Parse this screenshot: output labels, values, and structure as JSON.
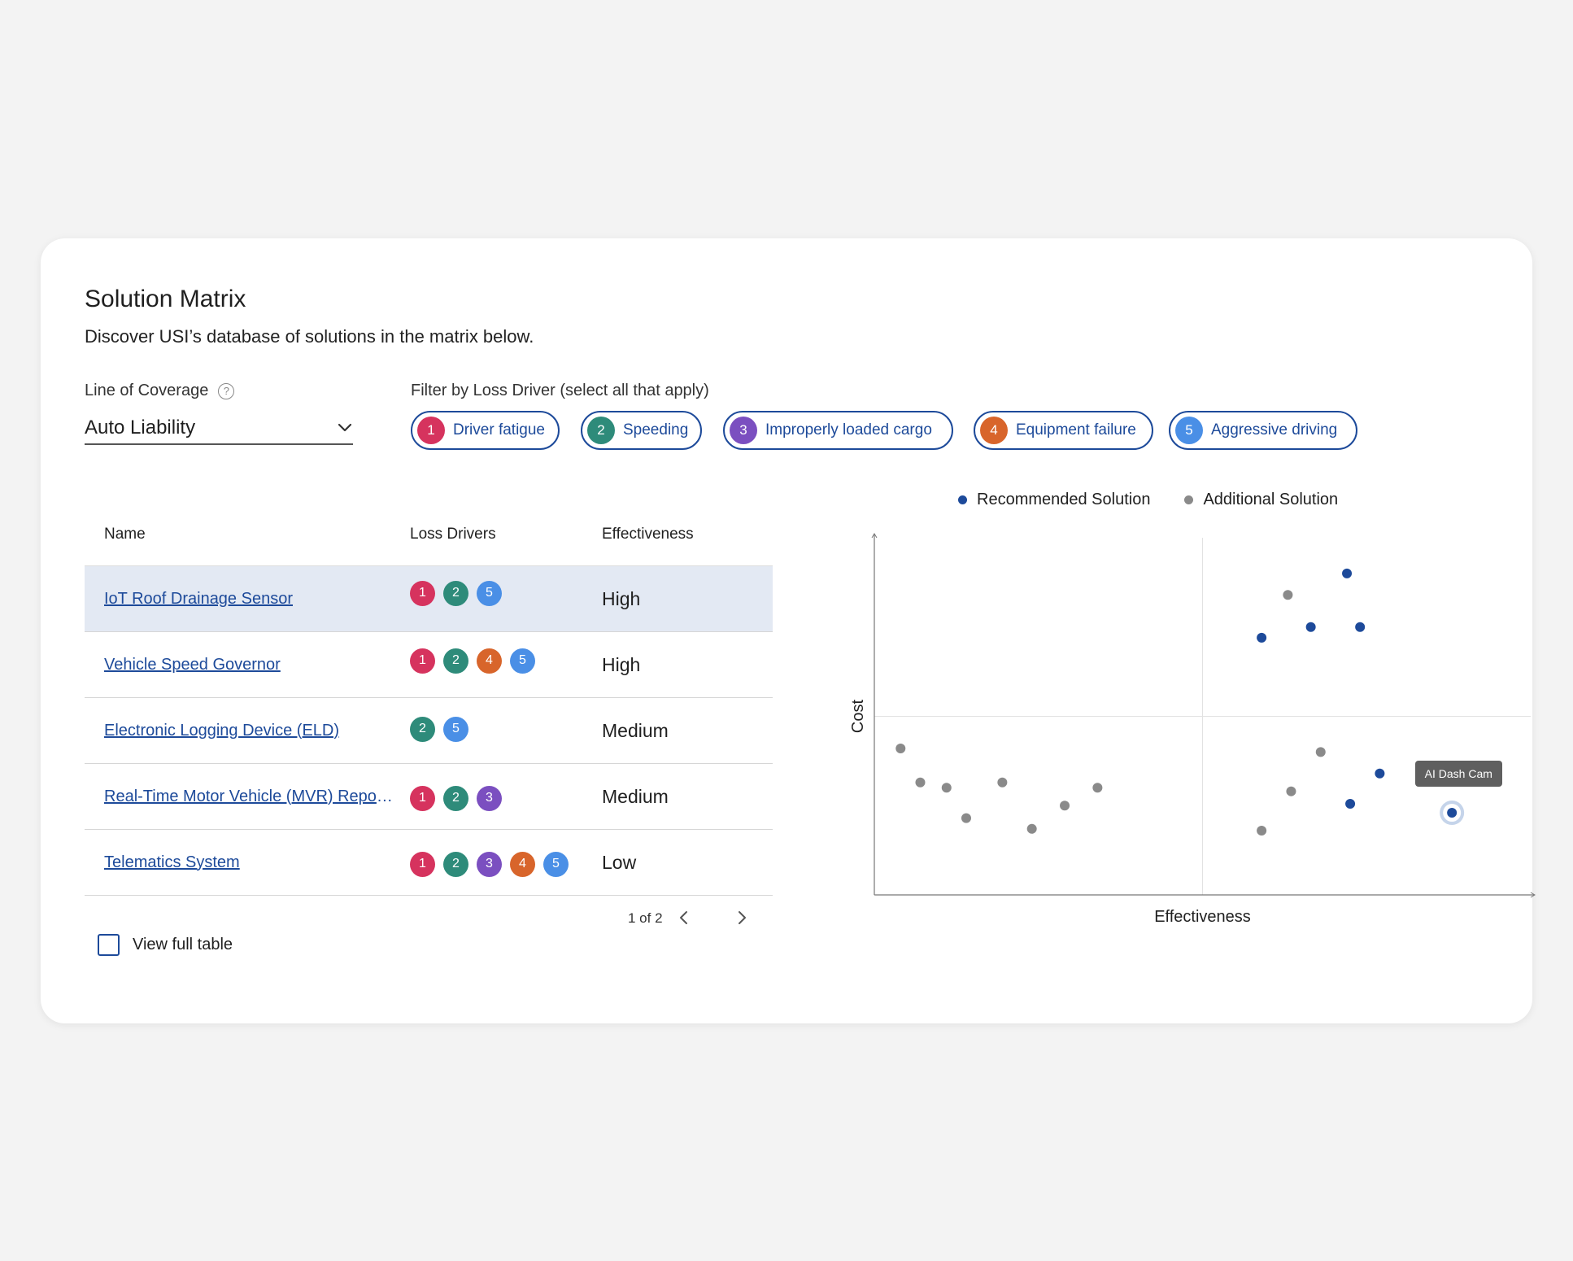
{
  "header": {
    "title": "Solution Matrix",
    "subtitle": "Discover USI’s database of solutions in the matrix below."
  },
  "coverage": {
    "label": "Line of Coverage",
    "help_icon": "?",
    "value": "Auto Liability"
  },
  "filter": {
    "label": "Filter by Loss Driver (select all that apply)",
    "chips": [
      {
        "num": "1",
        "label": "Driver fatigue",
        "color": "#d6335e"
      },
      {
        "num": "2",
        "label": "Speeding",
        "color": "#2e8b7a"
      },
      {
        "num": "3",
        "label": "Improperly loaded cargo",
        "color": "#7b4fc0"
      },
      {
        "num": "4",
        "label": "Equipment failure",
        "color": "#d8652b"
      },
      {
        "num": "5",
        "label": "Aggressive driving",
        "color": "#4a8fe6"
      }
    ]
  },
  "table": {
    "headers": {
      "name": "Name",
      "drivers": "Loss Drivers",
      "effectiveness": "Effectiveness"
    },
    "rows": [
      {
        "name": "IoT Roof Drainage Sensor",
        "drivers": [
          "1",
          "2",
          "5"
        ],
        "effectiveness": "High",
        "selected": true
      },
      {
        "name": "Vehicle Speed Governor",
        "drivers": [
          "1",
          "2",
          "4",
          "5"
        ],
        "effectiveness": "High"
      },
      {
        "name": "Electronic Logging Device (ELD)",
        "drivers": [
          "2",
          "5"
        ],
        "effectiveness": "Medium"
      },
      {
        "name": "Real-Time Motor Vehicle (MVR) Report...",
        "drivers": [
          "1",
          "2",
          "3"
        ],
        "effectiveness": "Medium"
      },
      {
        "name": "Telematics System",
        "drivers": [
          "1",
          "2",
          "3",
          "4",
          "5"
        ],
        "effectiveness": "Low"
      }
    ],
    "pagination": "1 of 2",
    "view_full_label": "View full table"
  },
  "driver_colors": {
    "1": "#d6335e",
    "2": "#2e8b7a",
    "3": "#7b4fc0",
    "4": "#d8652b",
    "5": "#4a8fe6"
  },
  "legend": {
    "recommended": {
      "label": "Recommended Solution",
      "color": "#1d4a9a"
    },
    "additional": {
      "label": "Additional Solution",
      "color": "#8a8a8a"
    }
  },
  "chart_data": {
    "type": "scatter",
    "xlabel": "Effectiveness",
    "ylabel": "Cost",
    "xlim": [
      0,
      100
    ],
    "ylim": [
      0,
      100
    ],
    "quadrant_lines": {
      "x": 50,
      "y": 50
    },
    "series": [
      {
        "name": "Recommended Solution",
        "color": "#1d4a9a",
        "points": [
          [
            72,
            90
          ],
          [
            59,
            72
          ],
          [
            66.5,
            75
          ],
          [
            74,
            75
          ],
          [
            77,
            34
          ],
          [
            72.5,
            25.5
          ],
          [
            88,
            23
          ]
        ]
      },
      {
        "name": "Additional Solution",
        "color": "#8a8a8a",
        "points": [
          [
            63,
            84
          ],
          [
            4,
            41
          ],
          [
            7,
            31.5
          ],
          [
            11,
            30
          ],
          [
            14,
            21.5
          ],
          [
            19.5,
            31.5
          ],
          [
            24,
            18.5
          ],
          [
            29,
            25
          ],
          [
            34,
            30
          ],
          [
            68,
            40
          ],
          [
            63.5,
            29
          ],
          [
            59,
            18
          ]
        ]
      }
    ],
    "highlight": {
      "label": "AI Dash Cam",
      "x": 88,
      "y": 23
    }
  }
}
